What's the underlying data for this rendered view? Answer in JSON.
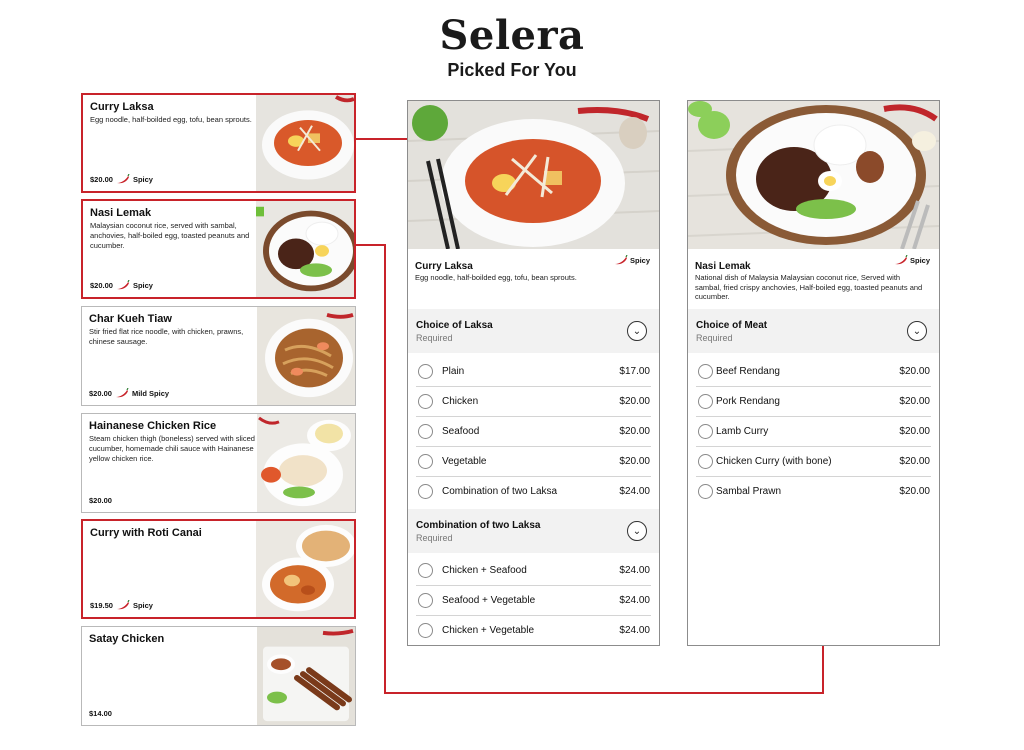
{
  "header": {
    "brand": "Selera",
    "subtitle": "Picked For You"
  },
  "accent_color": "#c8232a",
  "menu": [
    {
      "name": "Curry Laksa",
      "desc": "Egg noodle, half-boilded egg, tofu, bean sprouts.",
      "price": "$20.00",
      "spice": "Spicy",
      "selected": true
    },
    {
      "name": "Nasi Lemak",
      "desc": "Malaysian coconut rice, served with sambal, anchovies, half-boiled egg, toasted peanuts and cucumber.",
      "price": "$20.00",
      "spice": "Spicy",
      "selected": true
    },
    {
      "name": "Char Kueh Tiaw",
      "desc": "Stir fried flat rice noodle, with chicken, prawns, chinese sausage.",
      "price": "$20.00",
      "spice": "Mild Spicy",
      "selected": false
    },
    {
      "name": "Hainanese Chicken Rice",
      "desc": "Steam chicken thigh (boneless) served with sliced cucumber, homemade chili sauce with Hainanese yellow chicken rice.",
      "price": "$20.00",
      "spice": "",
      "selected": false
    },
    {
      "name": "Curry with Roti Canai",
      "desc": "",
      "price": "$19.50",
      "spice": "Spicy",
      "selected": true
    },
    {
      "name": "Satay Chicken",
      "desc": "",
      "price": "$14.00",
      "spice": "",
      "selected": false
    }
  ],
  "detail_laksa": {
    "title": "Curry Laksa",
    "desc": "Egg noodle, half-boilded egg, tofu, bean sprouts.",
    "spice": "Spicy",
    "groups": [
      {
        "title": "Choice of Laksa",
        "required": "Required",
        "options": [
          {
            "label": "Plain",
            "price": "$17.00"
          },
          {
            "label": "Chicken",
            "price": "$20.00"
          },
          {
            "label": "Seafood",
            "price": "$20.00"
          },
          {
            "label": "Vegetable",
            "price": "$20.00"
          },
          {
            "label": "Combination of two Laksa",
            "price": "$24.00"
          }
        ]
      },
      {
        "title": "Combination of two Laksa",
        "required": "Required",
        "options": [
          {
            "label": "Chicken + Seafood",
            "price": "$24.00"
          },
          {
            "label": "Seafood + Vegetable",
            "price": "$24.00"
          },
          {
            "label": "Chicken + Vegetable",
            "price": "$24.00"
          }
        ]
      }
    ]
  },
  "detail_nasi": {
    "title": "Nasi Lemak",
    "desc": "National dish of Malaysia Malaysian coconut rice, Served with sambal, fried crispy anchovies, Half-boiled egg, toasted peanuts and cucumber.",
    "spice": "Spicy",
    "groups": [
      {
        "title": "Choice of Meat",
        "required": "Required",
        "options": [
          {
            "label": "Beef Rendang",
            "price": "$20.00"
          },
          {
            "label": "Pork Rendang",
            "price": "$20.00"
          },
          {
            "label": "Lamb Curry",
            "price": "$20.00"
          },
          {
            "label": "Chicken Curry (with bone)",
            "price": "$20.00"
          },
          {
            "label": "Sambal Prawn",
            "price": "$20.00"
          }
        ]
      }
    ]
  }
}
